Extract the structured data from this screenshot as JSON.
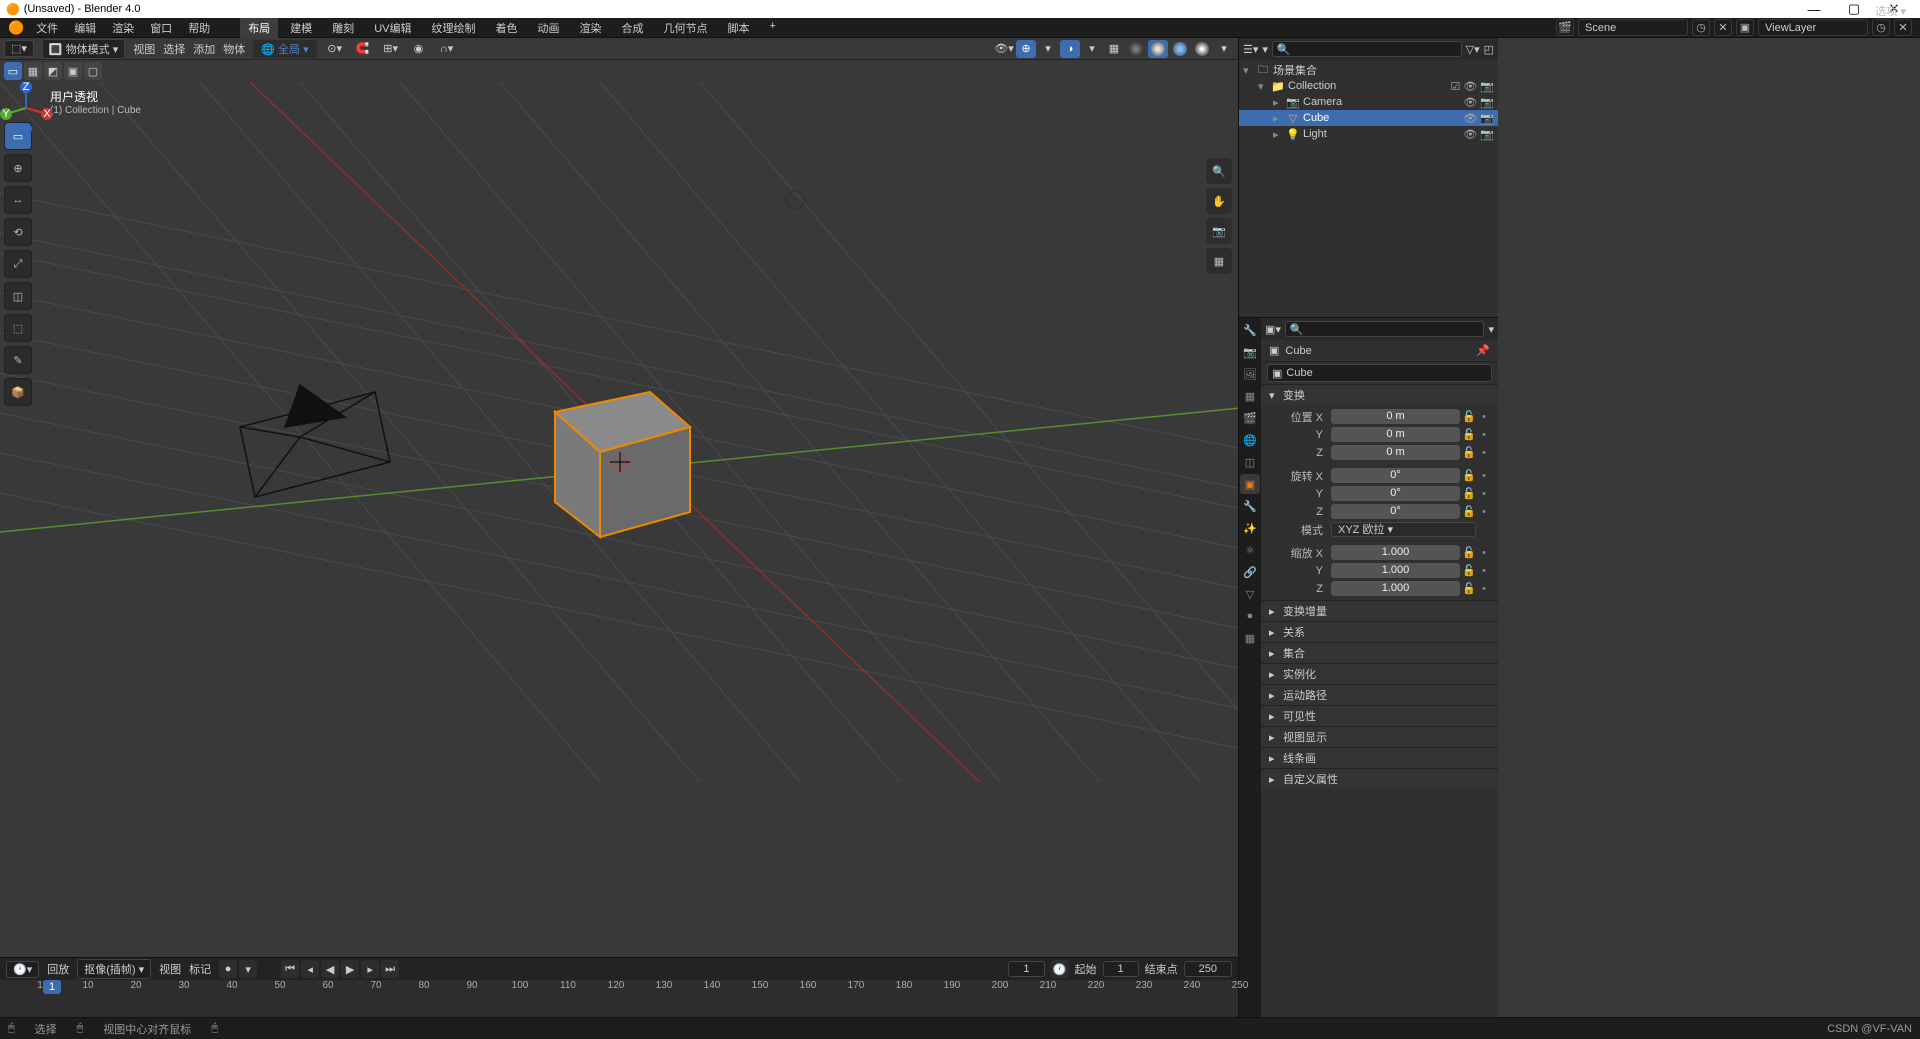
{
  "titlebar": {
    "icon": "🟠",
    "title": "(Unsaved) - Blender 4.0",
    "min": "—",
    "max": "▢",
    "close": "✕"
  },
  "menus": [
    "文件",
    "编辑",
    "渲染",
    "窗口",
    "帮助"
  ],
  "workspaces": [
    "布局",
    "建模",
    "雕刻",
    "UV编辑",
    "纹理绘制",
    "着色",
    "动画",
    "渲染",
    "合成",
    "几何节点",
    "脚本"
  ],
  "scene_label": "Scene",
  "layer_label": "ViewLayer",
  "viewport": {
    "mode": "物体模式",
    "menus": [
      "视图",
      "选择",
      "添加",
      "物体"
    ],
    "global": "全局",
    "options": "选项",
    "selmodes": [
      "▭",
      "▦",
      "◩",
      "▣",
      "▢"
    ],
    "label1": "用户透视",
    "label2": "(1) Collection | Cube",
    "tools": [
      "▭",
      "⊕",
      "↔",
      "⟲",
      "⤢",
      "◫",
      "⬚",
      "✎",
      "📐",
      "📦"
    ]
  },
  "outliner": {
    "root": "场景集合",
    "items": [
      {
        "name": "Collection",
        "icon": "📁",
        "tw": "▾",
        "indent": 1
      },
      {
        "name": "Camera",
        "icon": "📷",
        "tw": "▸",
        "indent": 2
      },
      {
        "name": "Cube",
        "icon": "▽",
        "tw": "▸",
        "indent": 2,
        "selected": true
      },
      {
        "name": "Light",
        "icon": "💡",
        "tw": "▸",
        "indent": 2
      }
    ]
  },
  "properties": {
    "object": "Cube",
    "datablock": "Cube",
    "panels": {
      "transform": {
        "title": "变换",
        "open": true
      },
      "delta": {
        "title": "变换增量"
      },
      "relations": {
        "title": "关系"
      },
      "collections": {
        "title": "集合"
      },
      "instancing": {
        "title": "实例化"
      },
      "motion": {
        "title": "运动路径"
      },
      "visibility": {
        "title": "可见性"
      },
      "viewport": {
        "title": "视图显示"
      },
      "lineart": {
        "title": "线条画"
      },
      "custom": {
        "title": "自定义属性"
      }
    },
    "transform": {
      "loc_label": "位置 X",
      "loc_x": "0 m",
      "loc_y": "0 m",
      "loc_z": "0 m",
      "rot_label": "旋转 X",
      "rot_x": "0°",
      "rot_y": "0°",
      "rot_z": "0°",
      "mode_label": "模式",
      "mode": "XYZ 欧拉",
      "scale_label": "缩放 X",
      "scale_x": "1.000",
      "scale_y": "1.000",
      "scale_z": "1.000"
    }
  },
  "timeline": {
    "menus": [
      "回放",
      "抠像(插帧)",
      "视图",
      "标记"
    ],
    "current": "1",
    "start_label": "起始",
    "start": "1",
    "end_label": "结束点",
    "end": "250",
    "ticks": [
      1,
      10,
      20,
      30,
      40,
      50,
      60,
      70,
      80,
      90,
      100,
      110,
      120,
      130,
      140,
      150,
      160,
      170,
      180,
      190,
      200,
      210,
      220,
      230,
      240,
      250
    ]
  },
  "status": {
    "s1": "选择",
    "s2": "视图中心对齐鼠标",
    "ver": "CSDN @VF-VAN"
  }
}
